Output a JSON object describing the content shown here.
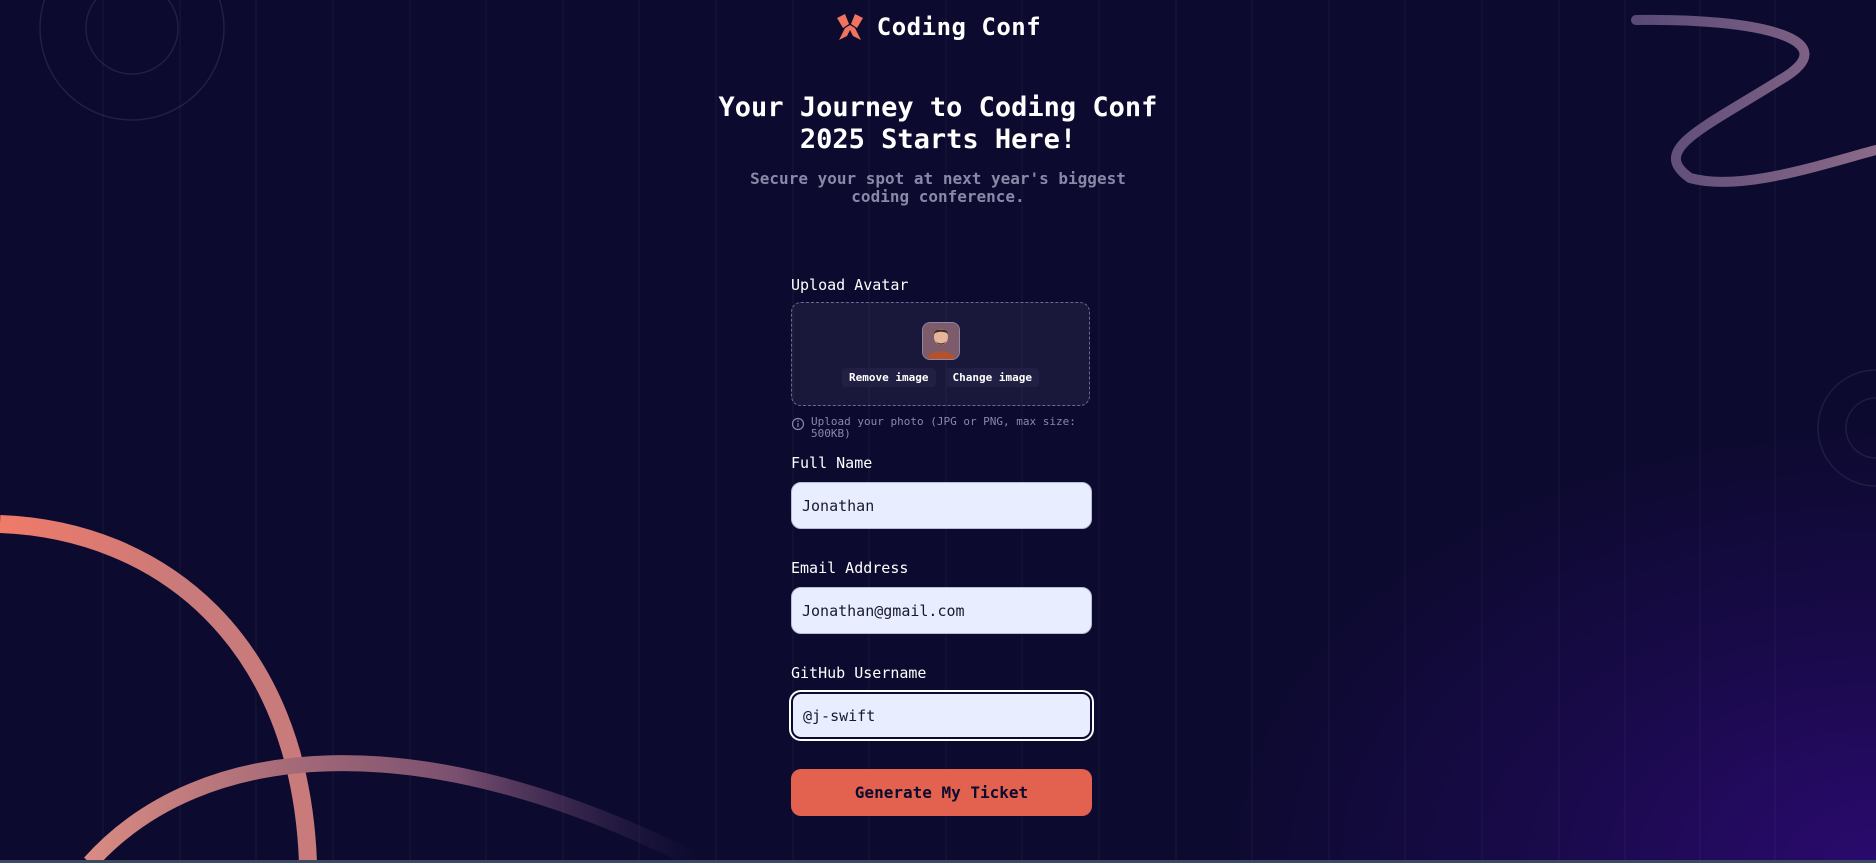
{
  "brand": {
    "name": "Coding Conf",
    "icon": "logo-icon"
  },
  "hero": {
    "title": "Your Journey to Coding Conf 2025 Starts Here!",
    "subtitle": "Secure your spot at next year's biggest coding conference."
  },
  "form": {
    "avatar": {
      "label": "Upload Avatar",
      "remove_label": "Remove image",
      "change_label": "Change image",
      "hint": "Upload your photo (JPG or PNG, max size: 500KB)"
    },
    "full_name": {
      "label": "Full Name",
      "value": "Jonathan"
    },
    "email": {
      "label": "Email Address",
      "value": "Jonathan@gmail.com"
    },
    "github": {
      "label": "GitHub Username",
      "value": "@j-swift"
    },
    "submit_label": "Generate My Ticket"
  },
  "colors": {
    "background": "#0c0a2e",
    "accent": "#e2624f",
    "input_bg": "#e8eeff"
  }
}
